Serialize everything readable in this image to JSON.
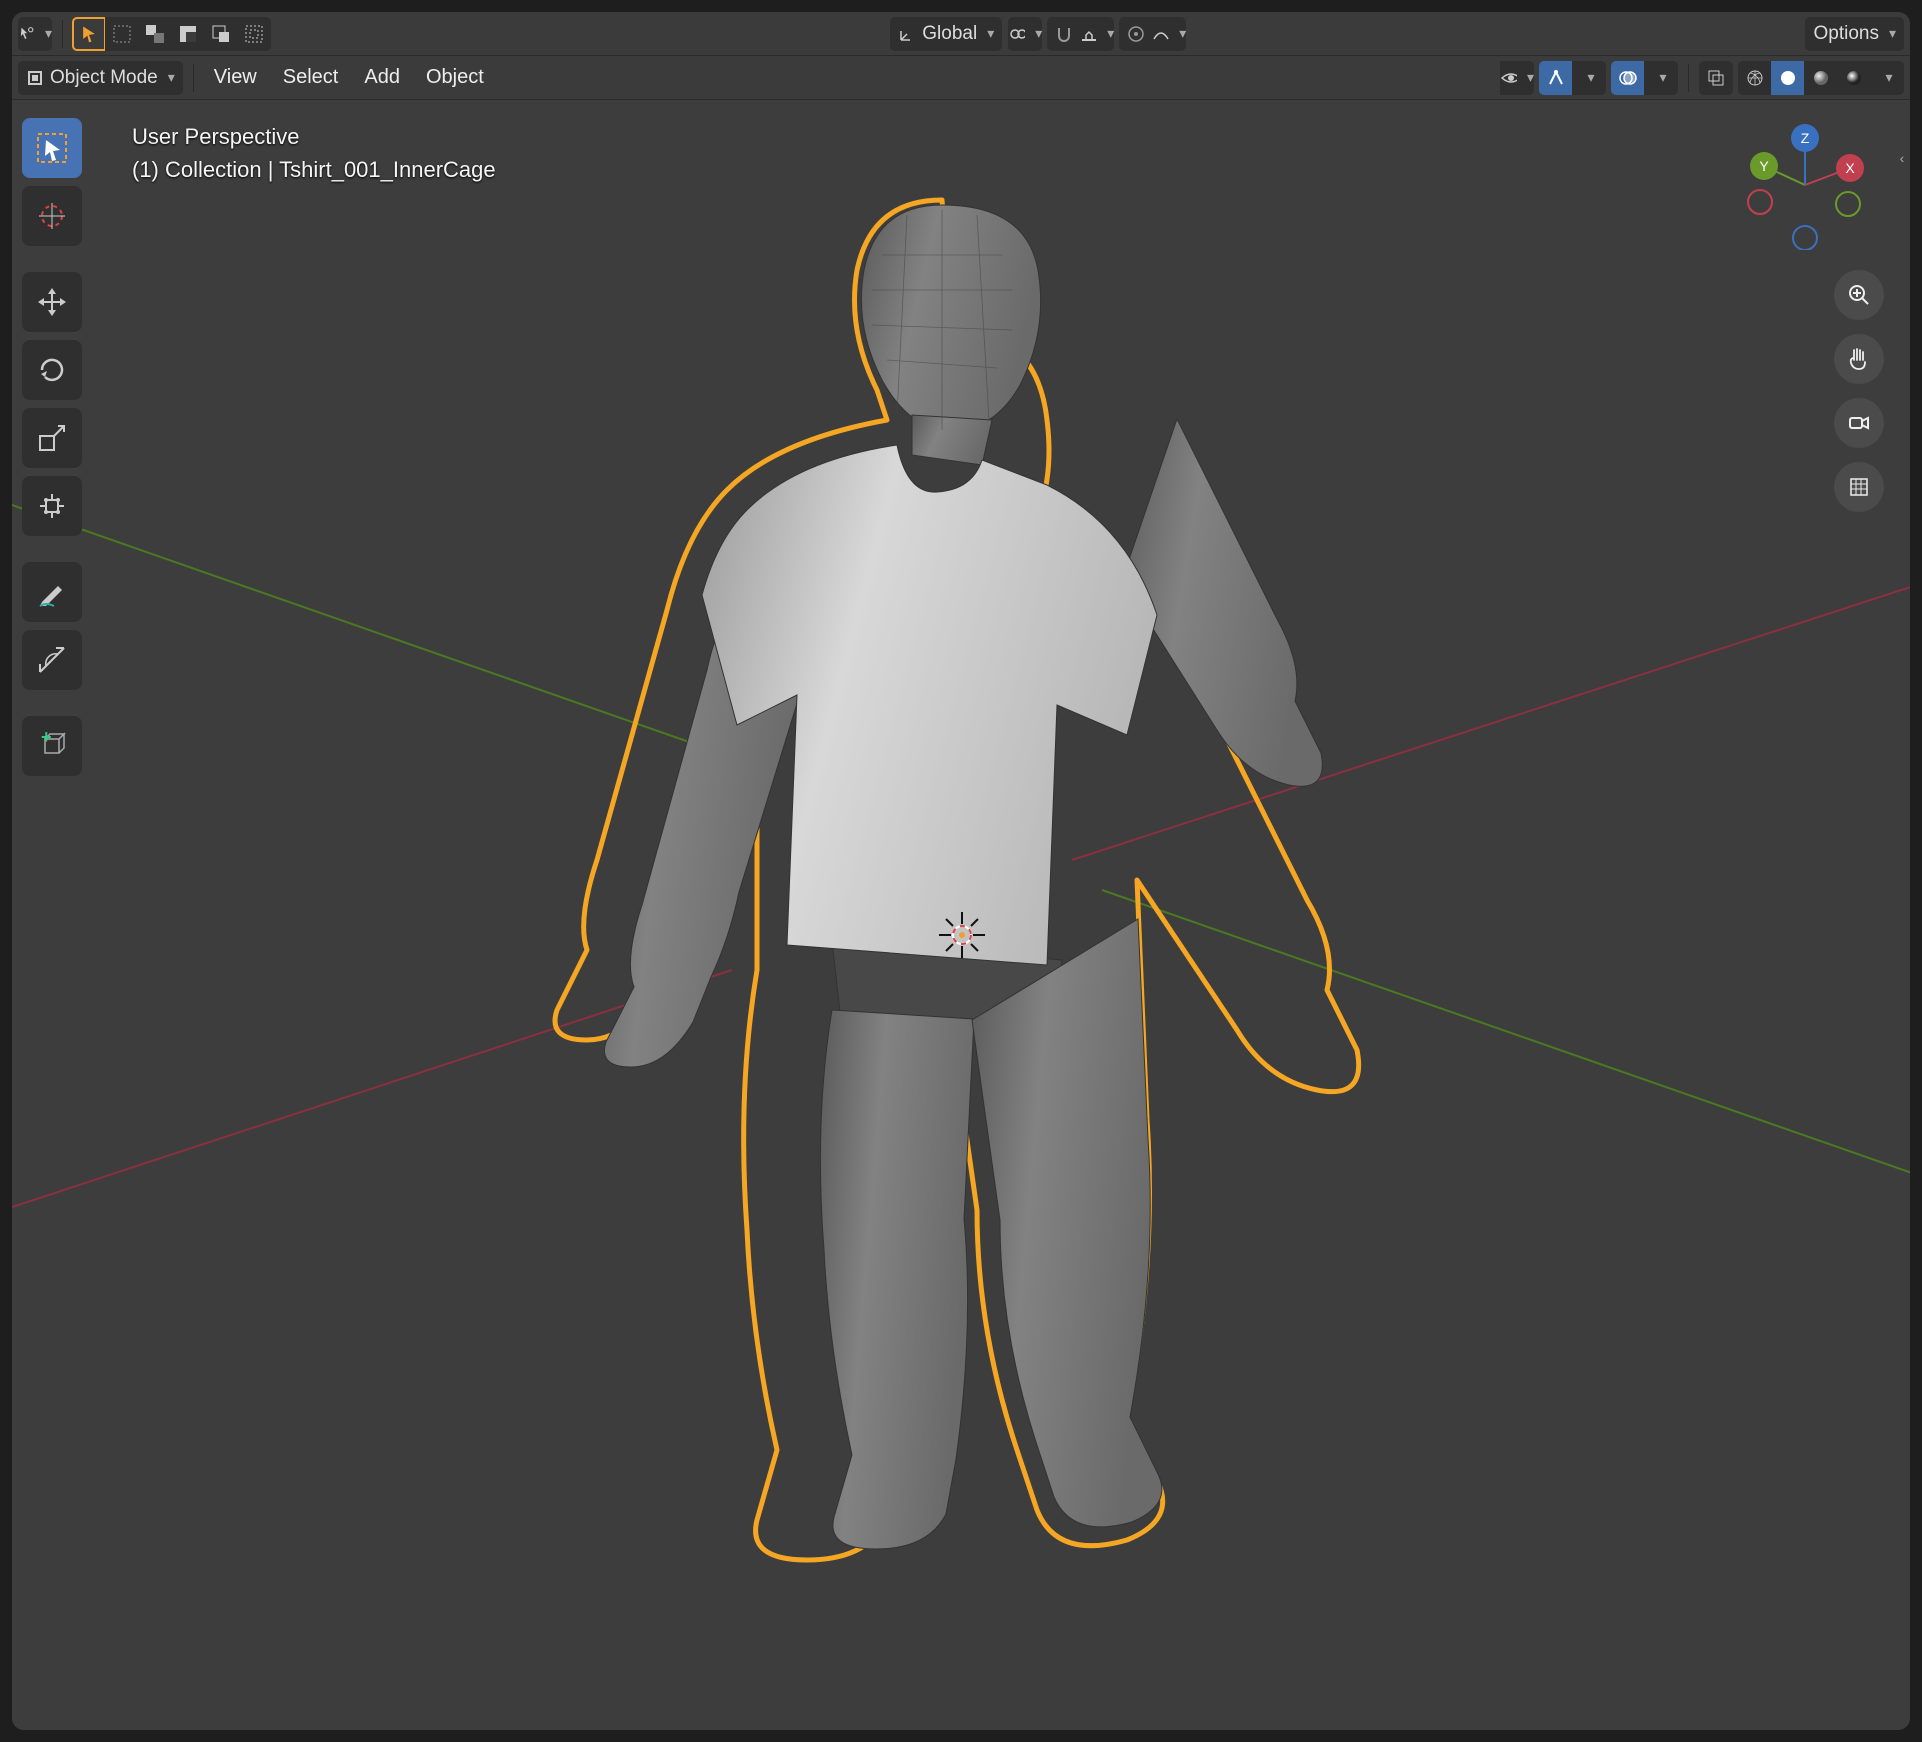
{
  "header": {
    "cursor_dropdown": "cursor-icon",
    "transform_orientation": "Global",
    "options_label": "Options"
  },
  "header2": {
    "mode_label": "Object Mode",
    "menus": [
      "View",
      "Select",
      "Add",
      "Object"
    ]
  },
  "overlay": {
    "line1": "User Perspective",
    "line2": "(1) Collection | Tshirt_001_InnerCage"
  },
  "gizmo": {
    "x": "X",
    "y": "Y",
    "z": "Z"
  },
  "colors": {
    "accent": "#4772b3",
    "outline": "#f5a623",
    "bg": "#3d3d3d",
    "axis_x": "#a03040",
    "axis_y": "#58902a",
    "axis_z": "#3a70c0"
  }
}
